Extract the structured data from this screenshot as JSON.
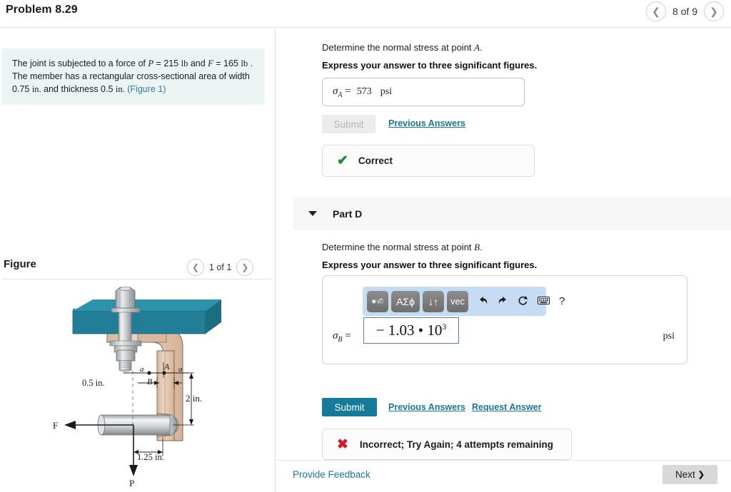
{
  "header": {
    "problem_title": "Problem 8.29",
    "pager_label": "8 of 9",
    "prev_icon": "chevron-left-icon",
    "next_icon": "chevron-right-icon"
  },
  "problem_statement": {
    "text_before_link": "The joint is subjected to a force of P = 215 lb and F = 165 lb . The member has a rectangular cross-sectional area of width 0.75 in. and thickness 0.5 in. ",
    "link_text": "(Figure 1)"
  },
  "figure_panel": {
    "title": "Figure",
    "pager_label": "1 of 1",
    "labels": {
      "point_a": "A",
      "point_b": "B",
      "section_a_left": "a",
      "section_a_right": "a",
      "dim_half_inch": "0.5 in.",
      "dim_two_inch": "2 in.",
      "dim_quarter": "1.25 in.",
      "force_f": "F",
      "force_p": "P"
    },
    "colors": {
      "plate_teal": "#217e96",
      "bracket_tan": "#e3c6ae",
      "steel_light": "#e6e6e6",
      "steel_dark": "#8a8f93"
    }
  },
  "part_c": {
    "prompt_prefix": "Determine the normal stress at point ",
    "prompt_symbol": "A",
    "prompt_suffix": ".",
    "express_note": "Express your answer to three significant figures.",
    "symbol_label": "σ",
    "symbol_sub": "A",
    "equals": "=",
    "value": "573",
    "unit": "psi",
    "submit_label": "Submit",
    "previous_answers_label": "Previous Answers",
    "status_icon": "check-icon",
    "status_label": "Correct",
    "status_color": "#1e8a3c"
  },
  "part_d": {
    "section_label": "Part D",
    "caret_icon": "caret-down-icon",
    "prompt_prefix": "Determine the normal stress at point ",
    "prompt_symbol": "B",
    "prompt_suffix": ".",
    "express_note": "Express your answer to three significant figures.",
    "math_toolbar": [
      {
        "name": "template-root-key",
        "label": "■√□",
        "type": "key"
      },
      {
        "name": "greek-symbols-key",
        "label": "ΑΣϕ",
        "type": "key"
      },
      {
        "name": "arrows-key",
        "label": "↓↑",
        "type": "key"
      },
      {
        "name": "vector-key",
        "label": "vec",
        "type": "key"
      },
      {
        "name": "undo-icon",
        "label": "↶",
        "type": "icon"
      },
      {
        "name": "redo-icon",
        "label": "↷",
        "type": "icon"
      },
      {
        "name": "reset-icon",
        "label": "↺",
        "type": "icon"
      },
      {
        "name": "keyboard-icon",
        "label": "⌨",
        "type": "icon"
      },
      {
        "name": "help-icon",
        "label": "?",
        "type": "icon"
      }
    ],
    "symbol_label": "σ",
    "symbol_sub": "B",
    "equals": "=",
    "answer_mantissa": "− 1.03 • 10",
    "answer_exponent": "3",
    "unit": "psi",
    "submit_label": "Submit",
    "previous_answers_label": "Previous Answers",
    "request_answer_label": "Request Answer",
    "status_icon": "x-icon",
    "status_label": "Incorrect; Try Again; 4 attempts remaining",
    "status_color": "#d7182a"
  },
  "footer": {
    "feedback_label": "Provide Feedback",
    "next_label": "Next",
    "next_icon": "chevron-right-icon"
  }
}
